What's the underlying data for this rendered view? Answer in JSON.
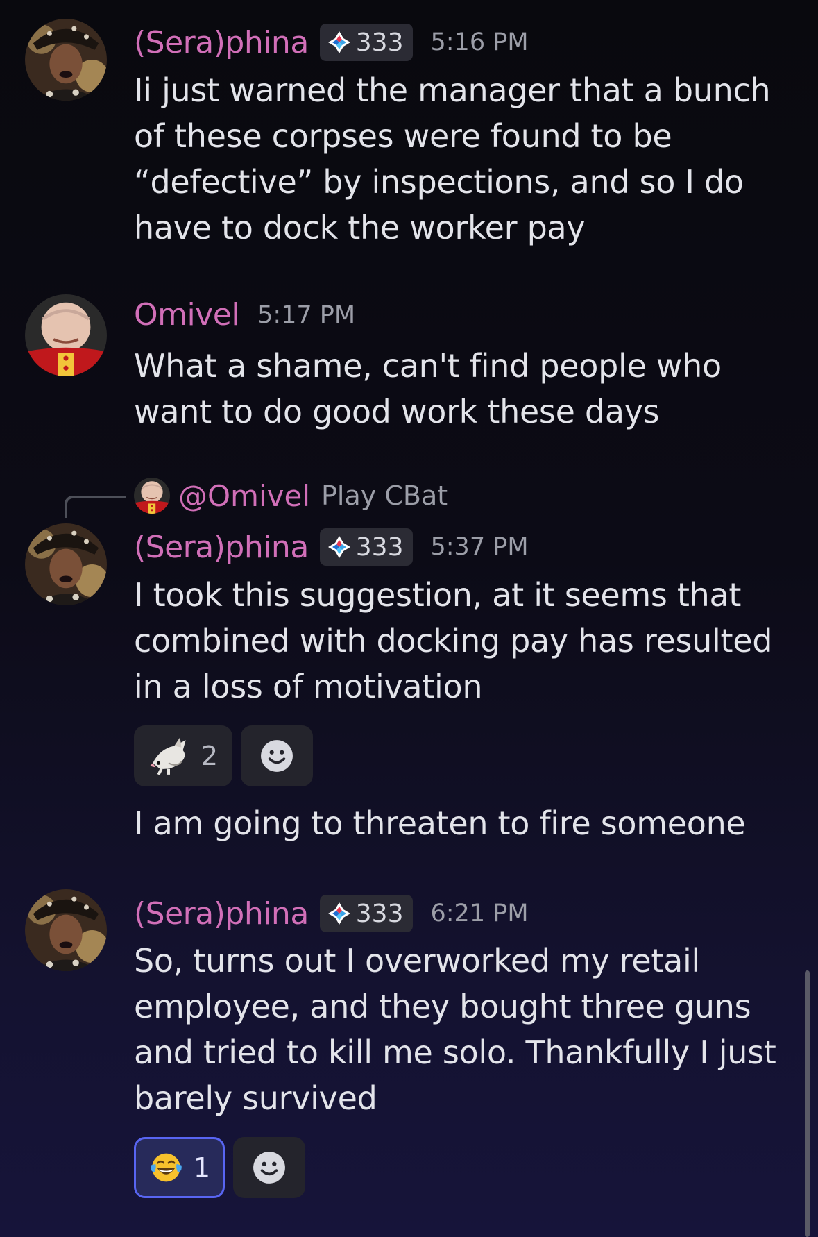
{
  "messages": [
    {
      "username": "(Sera)phina",
      "badge": "333",
      "time": "5:16 PM",
      "text": "Ii just warned the manager that a bunch of these corpses were found to be “defective” by inspections, and so I do have to dock the worker pay"
    },
    {
      "username": "Omivel",
      "time": "5:17 PM",
      "text": "What a shame, can't find people who want to do good work these days"
    },
    {
      "reply": {
        "name": "@Omivel",
        "text": "Play CBat"
      },
      "username": "(Sera)phina",
      "badge": "333",
      "time": "5:37 PM",
      "text": "I took this suggestion, at it seems that combined with docking pay has resulted in a loss of motivation",
      "reactions": [
        {
          "icon": "possum-emoji",
          "count": "2"
        }
      ],
      "followup": "I am going to threaten to fire someone"
    },
    {
      "username": "(Sera)phina",
      "badge": "333",
      "time": "6:21 PM",
      "text": "So, turns out I overworked my retail employee, and they bought three guns and tried to kill me solo. Thankfully I just barely survived",
      "reactions": [
        {
          "icon": "laughing-tears-emoji",
          "count": "1"
        }
      ]
    }
  ],
  "colors": {
    "username": "#d16fb8",
    "accent": "#5865f2"
  }
}
